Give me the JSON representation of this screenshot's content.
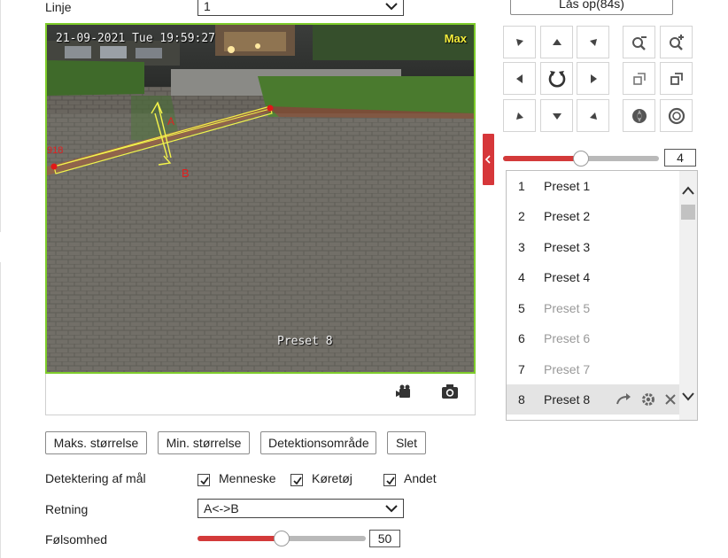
{
  "form": {
    "line_label": "Linje",
    "line_value": "1",
    "detection_label": "Detektering af mål",
    "targets": [
      {
        "label": "Menneske",
        "checked": true
      },
      {
        "label": "Køretøj",
        "checked": true
      },
      {
        "label": "Andet",
        "checked": true
      }
    ],
    "direction_label": "Retning",
    "direction_value": "A<->B",
    "sensitivity_label": "Følsomhed",
    "sensitivity_value": "50",
    "sensitivity_fraction": 0.5
  },
  "video": {
    "timestamp": "21-09-2021 Tue 19:59:27",
    "corner_label": "Max",
    "preset_overlay": "Preset 8",
    "marker_a": "A",
    "marker_b": "B",
    "marker_left": "918"
  },
  "buttons": {
    "max_size": "Maks. størrelse",
    "min_size": "Min. størrelse",
    "detection_area": "Detektionsområde",
    "delete": "Slet"
  },
  "ptz": {
    "unlock_label": "Lås op(84s)",
    "speed_value": "4",
    "speed_fraction": 0.5
  },
  "presets": [
    {
      "num": "1",
      "name": "Preset 1",
      "active": true
    },
    {
      "num": "2",
      "name": "Preset 2",
      "active": true
    },
    {
      "num": "3",
      "name": "Preset 3",
      "active": true
    },
    {
      "num": "4",
      "name": "Preset 4",
      "active": true
    },
    {
      "num": "5",
      "name": "Preset 5",
      "active": false
    },
    {
      "num": "6",
      "name": "Preset 6",
      "active": false
    },
    {
      "num": "7",
      "name": "Preset 7",
      "active": false
    },
    {
      "num": "8",
      "name": "Preset 8",
      "active": true,
      "selected": true
    }
  ],
  "colors": {
    "accent": "#d33a3a",
    "video_border": "#7ecc2a",
    "inactive_text": "#999999"
  }
}
